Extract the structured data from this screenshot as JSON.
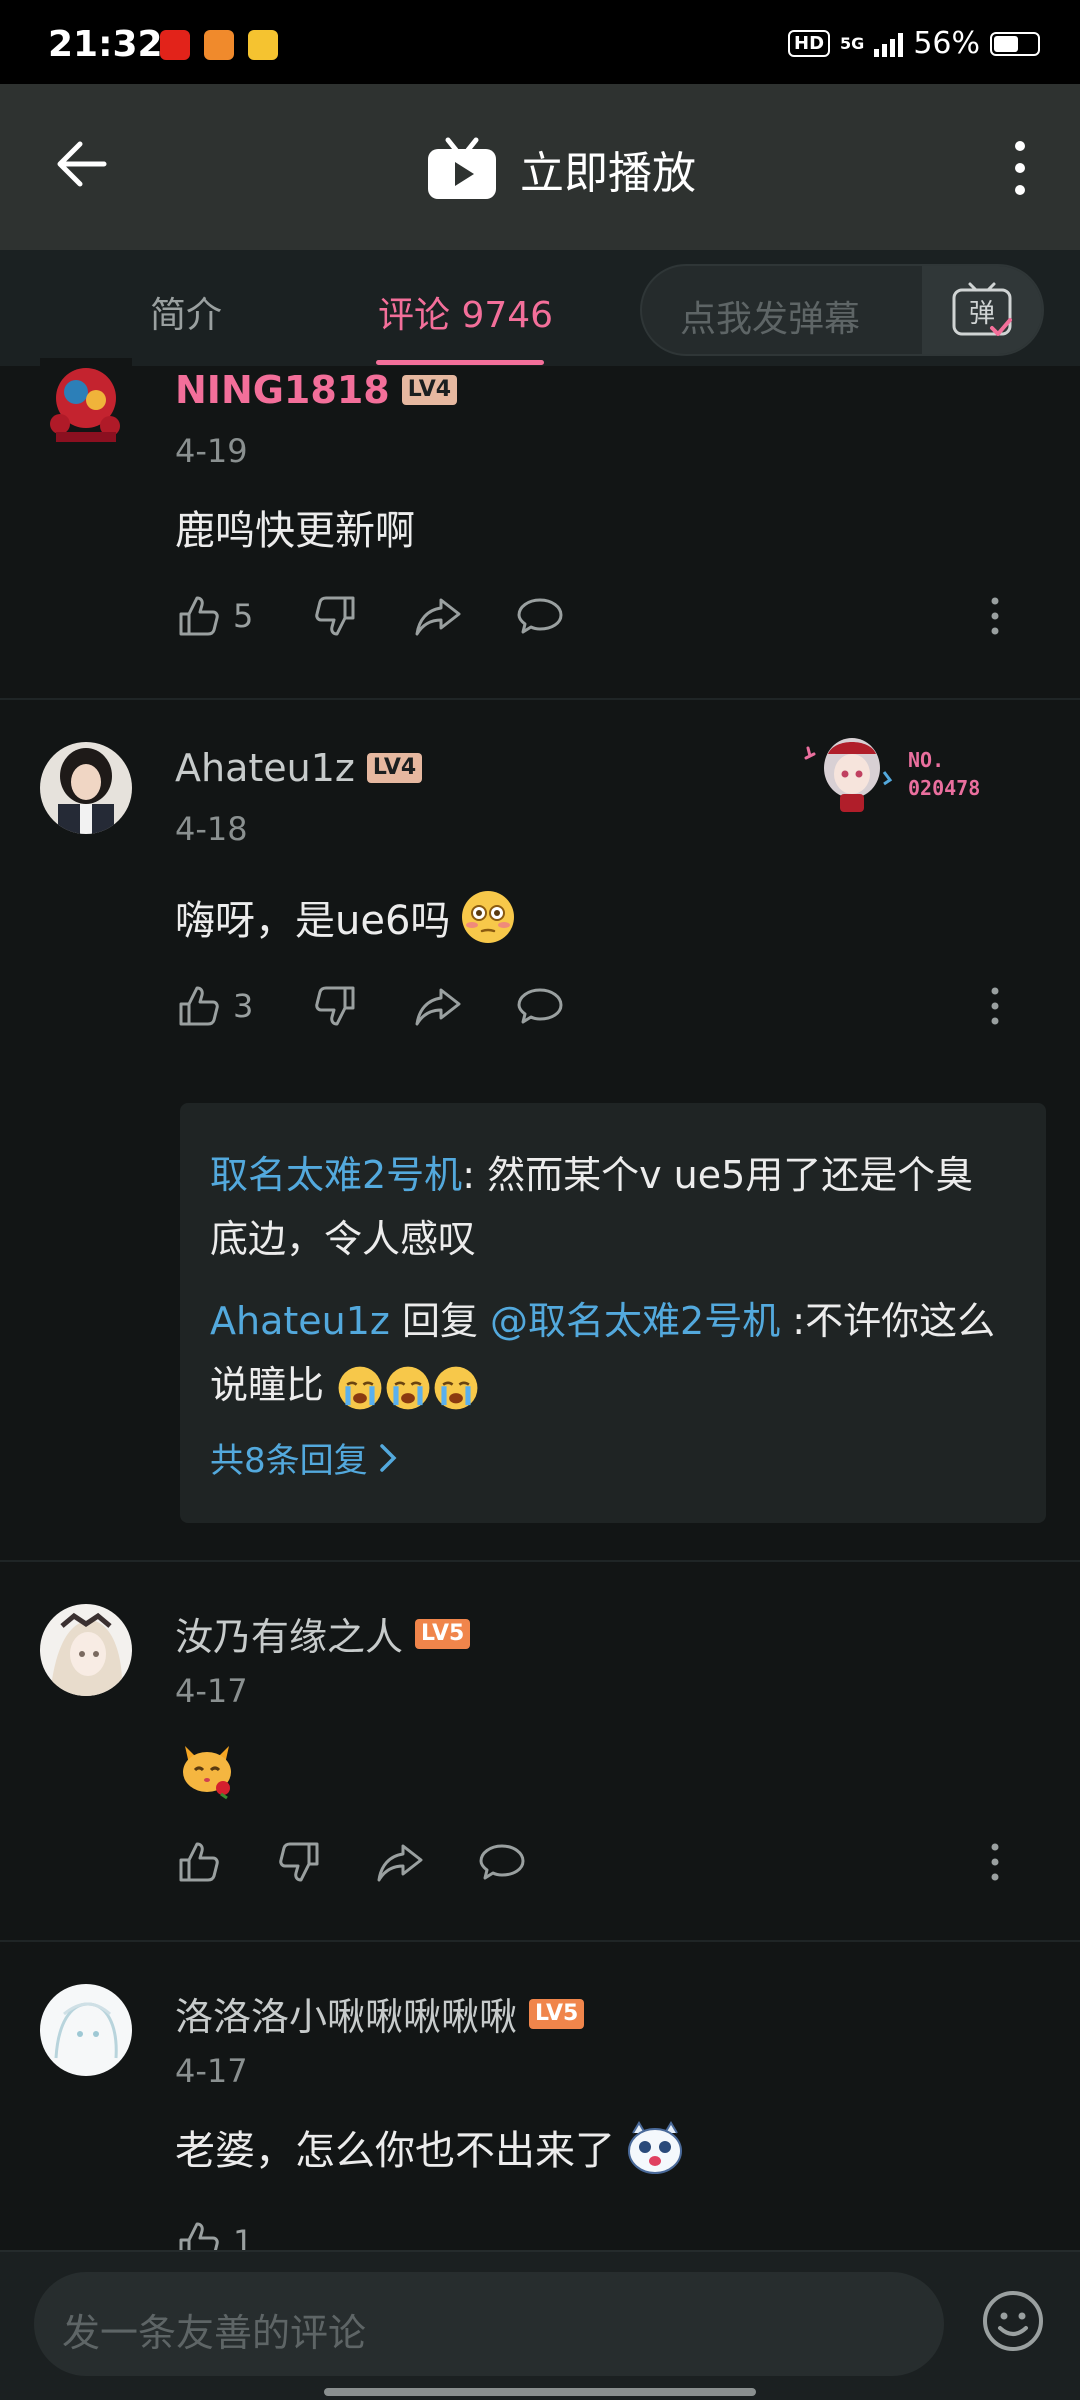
{
  "status_bar": {
    "time": "21:32",
    "hd": "HD",
    "network": "5G",
    "battery": "56%"
  },
  "header": {
    "title": "立即播放"
  },
  "tabs": {
    "intro": "简介",
    "comments": "评论 9746"
  },
  "danmaku": {
    "placeholder": "点我发弹幕",
    "button": "弹"
  },
  "comments": [
    {
      "user": "NING1818",
      "level": "LV4",
      "date": "4-19",
      "text": "鹿鸣快更新啊",
      "likes": "5"
    },
    {
      "user": "Ahateu1z",
      "level": "LV4",
      "date": "4-18",
      "text": "嗨呀，是ue6吗",
      "likes": "3",
      "fan_badge": {
        "no": "NO.",
        "num": "020478"
      },
      "replies": {
        "r1_name": "取名太难2号机",
        "r1_sep": ": ",
        "r1_text": "然而某个v ue5用了还是个臭底边，令人感叹",
        "r2_name": "Ahateu1z",
        "r2_verb": " 回复 ",
        "r2_mention": "@取名太难2号机",
        "r2_text": " :不许你这么说瞳比",
        "more": "共8条回复"
      }
    },
    {
      "user": "汝乃有缘之人",
      "level": "LV5",
      "date": "4-17"
    },
    {
      "user": "洛洛洛小啾啾啾啾啾",
      "level": "LV5",
      "date": "4-17",
      "text": "老婆，怎么你也不出来了",
      "likes": "1"
    }
  ],
  "bottom": {
    "placeholder": "发一条友善的评论"
  },
  "colors": {
    "accent_pink": "#f36f9a",
    "link_blue": "#53a9dd",
    "bg": "#121515"
  }
}
